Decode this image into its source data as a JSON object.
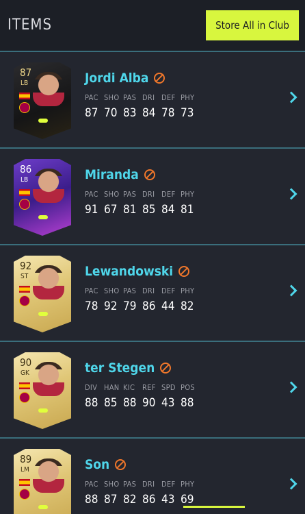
{
  "header": {
    "title": "ITEMS",
    "store_button_label": "Store All in Club"
  },
  "colors": {
    "accent_cyan": "#4fd6ea",
    "accent_lime": "#d8f63e",
    "untradeable_orange": "#f0772b",
    "background": "#23262f"
  },
  "players": [
    {
      "name": "Jordi Alba",
      "rating": "87",
      "position": "LB",
      "card_style": "black",
      "stat_labels": [
        "PAC",
        "SHO",
        "PAS",
        "DRI",
        "DEF",
        "PHY"
      ],
      "stat_values": [
        "87",
        "70",
        "83",
        "84",
        "78",
        "73"
      ]
    },
    {
      "name": "Miranda",
      "rating": "86",
      "position": "LB",
      "card_style": "purple",
      "stat_labels": [
        "PAC",
        "SHO",
        "PAS",
        "DRI",
        "DEF",
        "PHY"
      ],
      "stat_values": [
        "91",
        "67",
        "81",
        "85",
        "84",
        "81"
      ]
    },
    {
      "name": "Lewandowski",
      "rating": "92",
      "position": "ST",
      "card_style": "gold",
      "stat_labels": [
        "PAC",
        "SHO",
        "PAS",
        "DRI",
        "DEF",
        "PHY"
      ],
      "stat_values": [
        "78",
        "92",
        "79",
        "86",
        "44",
        "82"
      ]
    },
    {
      "name": "ter Stegen",
      "rating": "90",
      "position": "GK",
      "card_style": "gold",
      "stat_labels": [
        "DIV",
        "HAN",
        "KIC",
        "REF",
        "SPD",
        "POS"
      ],
      "stat_values": [
        "88",
        "85",
        "88",
        "90",
        "43",
        "88"
      ]
    },
    {
      "name": "Son",
      "rating": "89",
      "position": "LM",
      "card_style": "gold",
      "stat_labels": [
        "PAC",
        "SHO",
        "PAS",
        "DRI",
        "DEF",
        "PHY"
      ],
      "stat_values": [
        "88",
        "87",
        "82",
        "86",
        "43",
        "69"
      ]
    }
  ]
}
